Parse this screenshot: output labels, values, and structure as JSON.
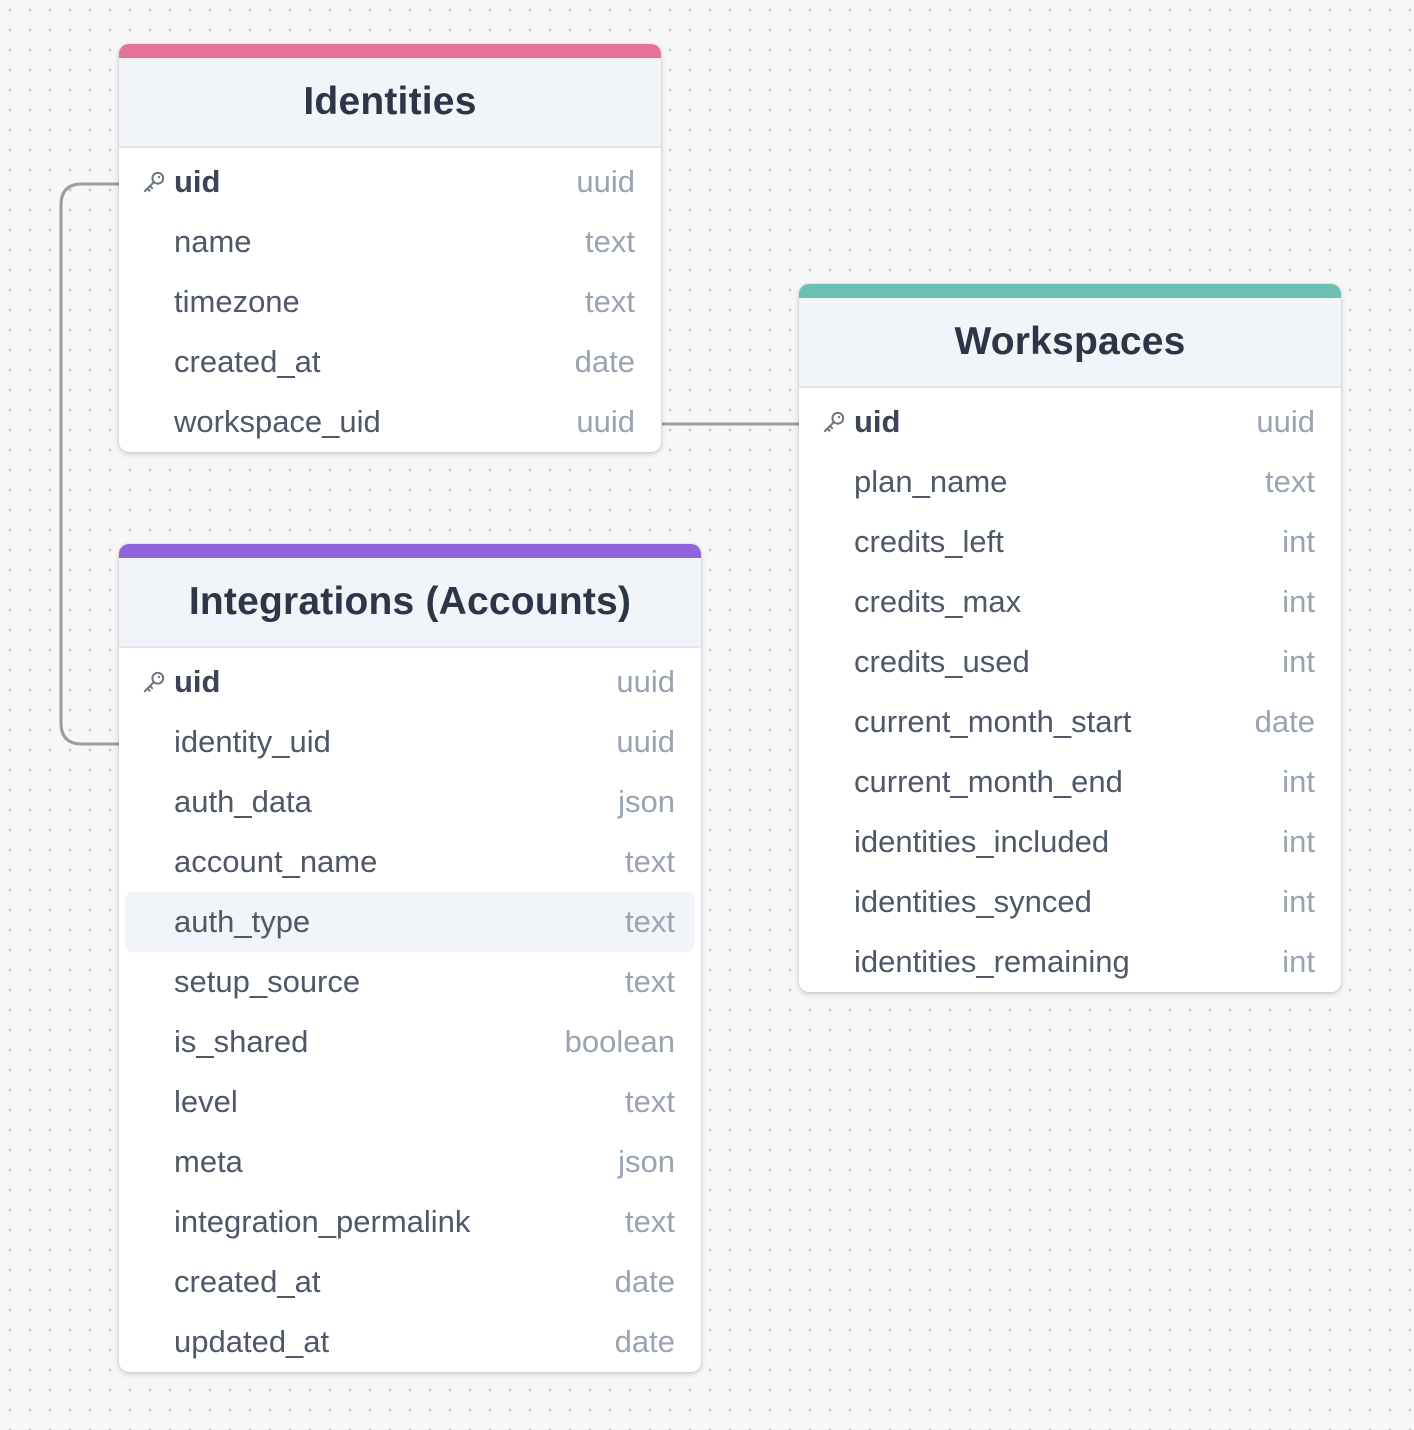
{
  "tables": {
    "identities": {
      "title": "Identities",
      "accent": "#e57399",
      "fields": [
        {
          "name": "uid",
          "type": "uuid",
          "pk": true
        },
        {
          "name": "name",
          "type": "text"
        },
        {
          "name": "timezone",
          "type": "text"
        },
        {
          "name": "created_at",
          "type": "date"
        },
        {
          "name": "workspace_uid",
          "type": "uuid"
        }
      ]
    },
    "workspaces": {
      "title": "Workspaces",
      "accent": "#6cbfb3",
      "fields": [
        {
          "name": "uid",
          "type": "uuid",
          "pk": true
        },
        {
          "name": "plan_name",
          "type": "text"
        },
        {
          "name": "credits_left",
          "type": "int"
        },
        {
          "name": "credits_max",
          "type": "int"
        },
        {
          "name": "credits_used",
          "type": "int"
        },
        {
          "name": "current_month_start",
          "type": "date"
        },
        {
          "name": "current_month_end",
          "type": "int"
        },
        {
          "name": "identities_included",
          "type": "int"
        },
        {
          "name": "identities_synced",
          "type": "int"
        },
        {
          "name": "identities_remaining",
          "type": "int"
        }
      ]
    },
    "integrations": {
      "title": "Integrations (Accounts)",
      "accent": "#8f63dc",
      "fields": [
        {
          "name": "uid",
          "type": "uuid",
          "pk": true
        },
        {
          "name": "identity_uid",
          "type": "uuid"
        },
        {
          "name": "auth_data",
          "type": "json"
        },
        {
          "name": "account_name",
          "type": "text"
        },
        {
          "name": "auth_type",
          "type": "text",
          "highlight": true
        },
        {
          "name": "setup_source",
          "type": "text"
        },
        {
          "name": "is_shared",
          "type": "boolean"
        },
        {
          "name": "level",
          "type": "text"
        },
        {
          "name": "meta",
          "type": "json"
        },
        {
          "name": "integration_permalink",
          "type": "text"
        },
        {
          "name": "created_at",
          "type": "date"
        },
        {
          "name": "updated_at",
          "type": "date"
        }
      ]
    }
  },
  "relations": [
    {
      "from": "identities.workspace_uid",
      "to": "workspaces.uid"
    },
    {
      "from": "integrations.identity_uid",
      "to": "identities.uid"
    }
  ],
  "colors": {
    "connector": "#999da3",
    "key_icon": "#6b7280"
  },
  "icons": {
    "primary_key": "key-icon"
  }
}
